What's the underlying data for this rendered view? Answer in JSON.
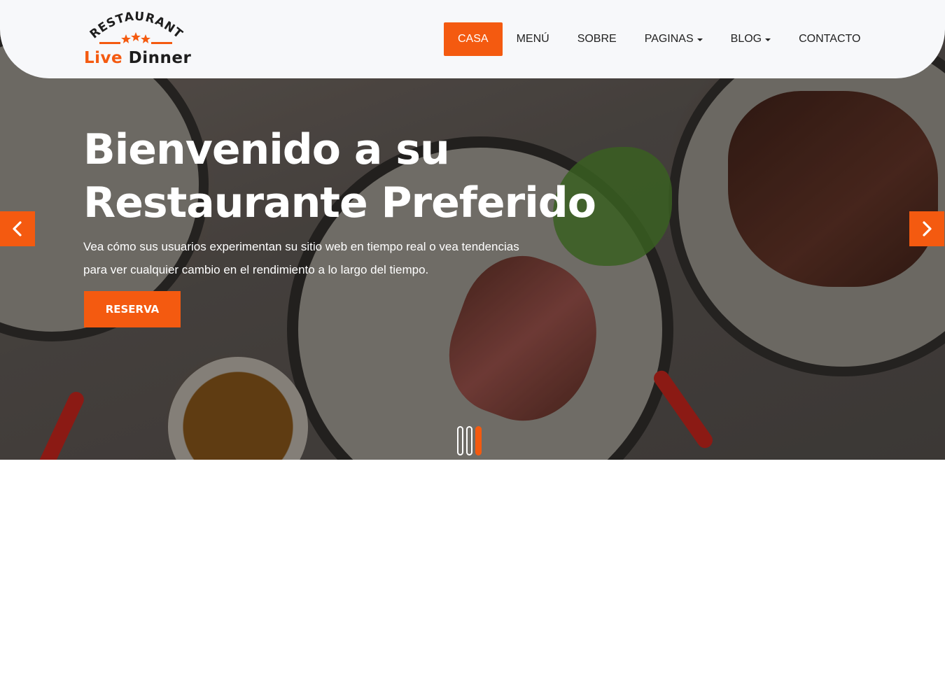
{
  "brand": {
    "arc_text": "RESTAURANT",
    "name_part1": "Live",
    "name_part2": "Dinner",
    "accent_color": "#f45a10"
  },
  "nav": {
    "items": [
      {
        "label": "CASA",
        "active": true
      },
      {
        "label": "MENÚ"
      },
      {
        "label": "SOBRE"
      },
      {
        "label": "PAGINAS",
        "dropdown": true
      },
      {
        "label": "BLOG",
        "dropdown": true
      },
      {
        "label": "CONTACTO"
      }
    ]
  },
  "hero": {
    "title_line1": "Bienvenido a su",
    "title_line2": "Restaurante Preferido",
    "description": "Vea cómo sus usuarios experimentan su sitio web en tiempo real o vea tendencias para ver cualquier cambio en el rendimiento a lo largo del tiempo.",
    "cta_label": "RESERVA"
  },
  "carousel": {
    "prev_icon": "chevron-left-icon",
    "next_icon": "chevron-right-icon",
    "slide_count": 3,
    "active_index": 2
  }
}
